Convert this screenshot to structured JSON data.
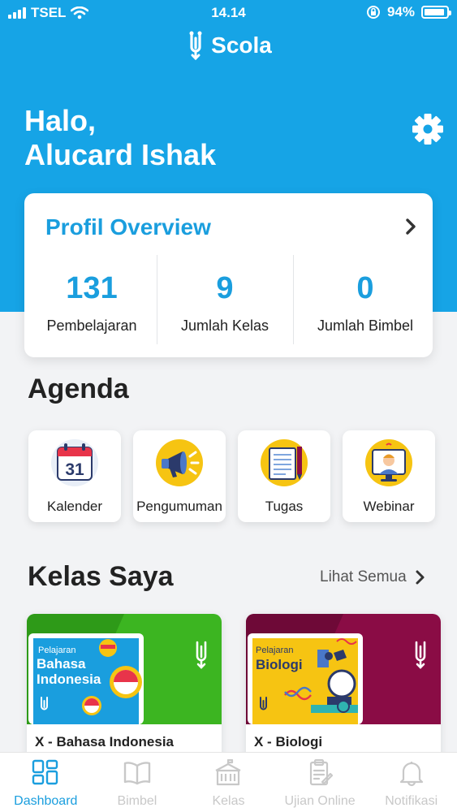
{
  "status_bar": {
    "carrier": "TSEL",
    "time": "14.14",
    "battery": "94%",
    "battery_level": 0.94
  },
  "app": {
    "name": "Scola"
  },
  "greeting": {
    "line1": "Halo,",
    "line2": "Alucard Ishak"
  },
  "profile_overview": {
    "title": "Profil Overview",
    "stats": [
      {
        "value": "131",
        "label": "Pembelajaran"
      },
      {
        "value": "9",
        "label": "Jumlah Kelas"
      },
      {
        "value": "0",
        "label": "Jumlah Bimbel"
      }
    ]
  },
  "agenda": {
    "title": "Agenda",
    "items": [
      {
        "label": "Kalender",
        "icon": "calendar-icon",
        "badge": "31"
      },
      {
        "label": "Pengumuman",
        "icon": "megaphone-icon"
      },
      {
        "label": "Tugas",
        "icon": "notebook-icon"
      },
      {
        "label": "Webinar",
        "icon": "webinar-icon"
      }
    ]
  },
  "classes": {
    "title": "Kelas Saya",
    "see_all": "Lihat Semua",
    "items": [
      {
        "name": "X - Bahasa Indonesia",
        "book_kicker": "Pelajaran",
        "book_title_line1": "Bahasa",
        "book_title_line2": "Indonesia",
        "color": "#3cb521"
      },
      {
        "name": "X - Biologi",
        "book_kicker": "Pelajaran",
        "book_title_line1": "Biologi",
        "book_title_line2": "",
        "color": "#8a0c45"
      }
    ]
  },
  "tabbar": {
    "items": [
      {
        "label": "Dashboard",
        "icon": "dashboard-icon",
        "active": true
      },
      {
        "label": "Bimbel",
        "icon": "book-icon",
        "active": false
      },
      {
        "label": "Kelas",
        "icon": "school-icon",
        "active": false
      },
      {
        "label": "Ujian Online",
        "icon": "exam-icon",
        "active": false
      },
      {
        "label": "Notifikasi",
        "icon": "bell-icon",
        "active": false
      }
    ]
  },
  "colors": {
    "primary": "#16a4e6",
    "accent_text": "#1a9ede",
    "inactive": "#c8c8c8"
  }
}
